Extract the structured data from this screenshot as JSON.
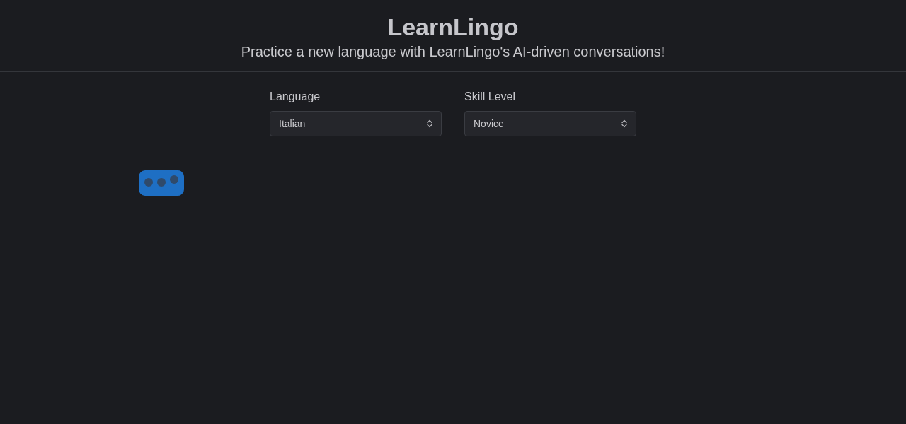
{
  "header": {
    "title": "LearnLingo",
    "subtitle": "Practice a new language with LearnLingo's AI-driven conversations!"
  },
  "settings": [
    {
      "label": "Language",
      "value": "Italian"
    },
    {
      "label": "Skill Level",
      "value": "Novice"
    }
  ],
  "chat": {
    "typing": true
  }
}
